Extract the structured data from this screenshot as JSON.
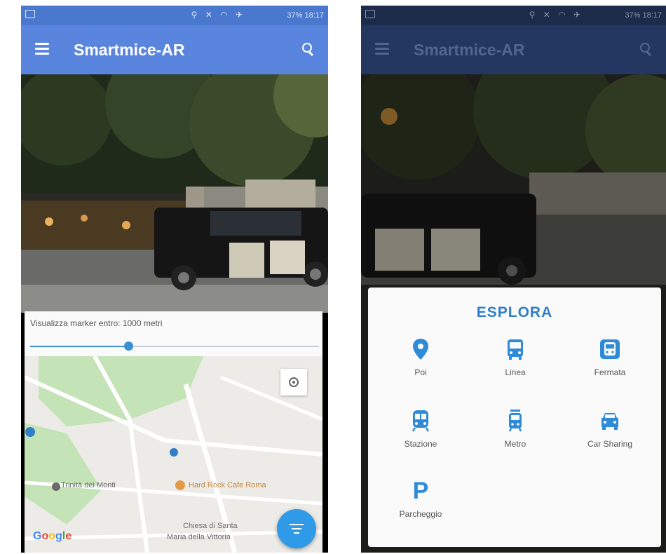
{
  "left": {
    "status": {
      "text": "37% 18:17"
    },
    "appbar": {
      "title": "Smartmice-AR"
    },
    "map_panel": {
      "marker_label": "Visualizza marker entro: 1000 metri",
      "slider_fraction": 0.34,
      "map_labels": [
        "Trinità dei Monti",
        "Hard Rock Cafe Roma",
        "Chiesa di Santa",
        "Maria della Vittoria"
      ],
      "google": [
        "G",
        "o",
        "o",
        "g",
        "l",
        "e"
      ]
    }
  },
  "right": {
    "status": {
      "text": "37% 18:17"
    },
    "appbar": {
      "title": "Smartmice-AR"
    },
    "esplora": {
      "title": "ESPLORA",
      "items": [
        {
          "label": "Poi",
          "icon": "poi-pin-icon"
        },
        {
          "label": "Linea",
          "icon": "bus-front-icon"
        },
        {
          "label": "Fermata",
          "icon": "bus-stop-icon"
        },
        {
          "label": "Stazione",
          "icon": "train-icon"
        },
        {
          "label": "Metro",
          "icon": "tram-icon"
        },
        {
          "label": "Car Sharing",
          "icon": "car-icon"
        },
        {
          "label": "Parcheggio",
          "icon": "parking-icon",
          "glyph": "P"
        }
      ]
    }
  },
  "colors": {
    "accent": "#2f8bd8",
    "appbar": "#5a85df"
  }
}
